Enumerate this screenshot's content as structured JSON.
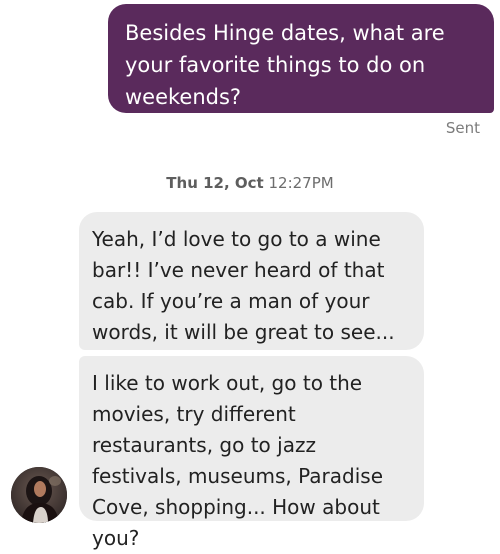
{
  "outgoing_message": {
    "text": "Besides Hinge dates, what are your favorite things to do on weekends?",
    "status": "Sent"
  },
  "timestamp": {
    "date": "Thu 12, Oct",
    "time": "12:27PM"
  },
  "incoming_messages": [
    {
      "text": "Yeah, I’d love to go to a wine bar!!  I’ve never heard of that cab. If you’re a man of your words, it will be great to see..."
    },
    {
      "text": "I like to work out, go to the movies, try different restaurants, go to jazz festivals, museums, Paradise Cove, shopping... How about you?"
    }
  ],
  "colors": {
    "outgoing_bubble": "#5a2a5c",
    "incoming_bubble": "#ececec",
    "status_text": "#7c7c7c"
  },
  "avatar": {
    "icon": "contact-avatar-photo"
  }
}
